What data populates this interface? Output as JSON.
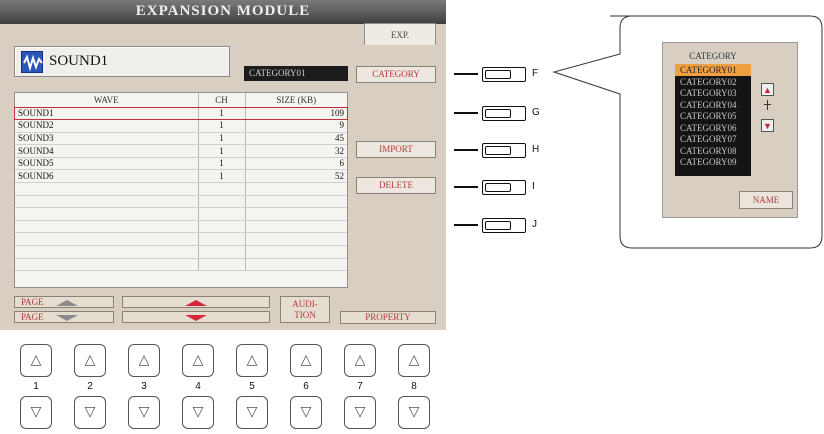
{
  "screen": {
    "title": "EXPANSION MODULE",
    "tab": "EXP.",
    "sound_name": "SOUND1",
    "category_value": "CATEGORY01",
    "category_button": "CATEGORY",
    "import_button": "IMPORT",
    "delete_button": "DELETE",
    "table": {
      "headers": {
        "wave": "WAVE",
        "ch": "CH",
        "size": "SIZE (KB)"
      },
      "rows": [
        {
          "wave": "SOUND1",
          "ch": "1",
          "size": "109"
        },
        {
          "wave": "SOUND2",
          "ch": "1",
          "size": "9"
        },
        {
          "wave": "SOUND3",
          "ch": "1",
          "size": "45"
        },
        {
          "wave": "SOUND4",
          "ch": "1",
          "size": "32"
        },
        {
          "wave": "SOUND5",
          "ch": "1",
          "size": "6"
        },
        {
          "wave": "SOUND6",
          "ch": "1",
          "size": "52"
        }
      ]
    },
    "bottom": {
      "page_up": "PAGE",
      "page_down": "PAGE",
      "audition_line1": "AUDI-",
      "audition_line2": "TION",
      "property": "PROPERTY"
    }
  },
  "side_buttons": [
    "F",
    "G",
    "H",
    "I",
    "J"
  ],
  "number_buttons": [
    "1",
    "2",
    "3",
    "4",
    "5",
    "6",
    "7",
    "8"
  ],
  "popup": {
    "title": "CATEGORY",
    "items": [
      "CATEGORY01",
      "CATEGORY02",
      "CATEGORY03",
      "CATEGORY04",
      "CATEGORY05",
      "CATEGORY06",
      "CATEGORY07",
      "CATEGORY08",
      "CATEGORY09"
    ],
    "name_button": "NAME"
  },
  "colors": {
    "accent_red": "#c0303e",
    "highlight_orange": "#f0a040",
    "screen_bg": "#d8cfc2"
  }
}
